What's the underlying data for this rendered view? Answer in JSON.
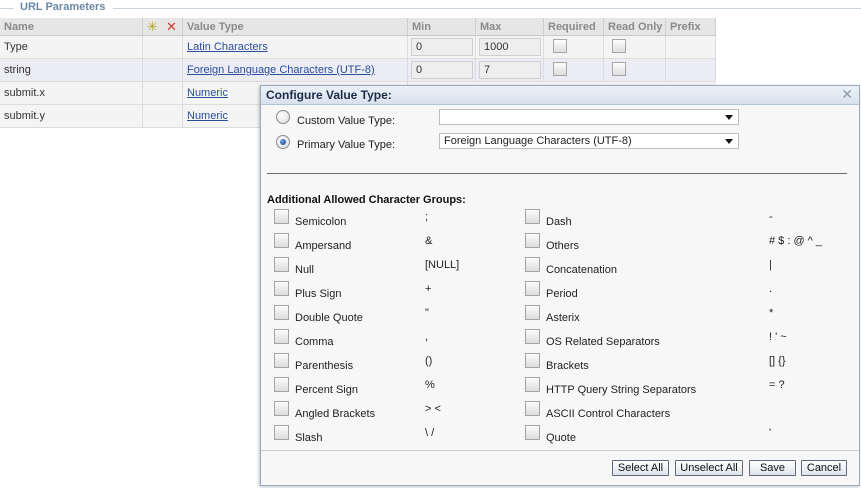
{
  "fieldset": {
    "legend": "URL Parameters"
  },
  "grid": {
    "headers": {
      "name": "Name",
      "value_type": "Value Type",
      "min": "Min",
      "max": "Max",
      "required": "Required",
      "read_only": "Read Only",
      "prefix": "Prefix"
    },
    "rows": [
      {
        "name": "Type",
        "value_type": "Latin Characters",
        "min": "0",
        "max": "1000"
      },
      {
        "name": "string",
        "value_type": "Foreign Language Characters (UTF-8)",
        "min": "0",
        "max": "7"
      },
      {
        "name": "submit.x",
        "value_type": "Numeric"
      },
      {
        "name": "submit.y",
        "value_type": "Numeric"
      }
    ]
  },
  "dialog": {
    "title": "Configure Value Type:",
    "close_icon": "close-icon",
    "custom_label": "Custom Value Type:",
    "custom_value": "",
    "primary_label": "Primary Value Type:",
    "primary_value": "Foreign Language Characters (UTF-8)",
    "section_title": "Additional Allowed Character Groups:",
    "groups_left": [
      {
        "label": "Semicolon",
        "symbol": ";"
      },
      {
        "label": "Ampersand",
        "symbol": "&"
      },
      {
        "label": "Null",
        "symbol": "[NULL]"
      },
      {
        "label": "Plus Sign",
        "symbol": "+"
      },
      {
        "label": "Double Quote",
        "symbol": "\""
      },
      {
        "label": "Comma",
        "symbol": ","
      },
      {
        "label": "Parenthesis",
        "symbol": "()"
      },
      {
        "label": "Percent Sign",
        "symbol": "%"
      },
      {
        "label": "Angled Brackets",
        "symbol": "> <"
      },
      {
        "label": "Slash",
        "symbol": "\\ /"
      }
    ],
    "groups_right": [
      {
        "label": "Dash",
        "symbol": "-"
      },
      {
        "label": "Others",
        "symbol": "# $ : @ ^ _"
      },
      {
        "label": "Concatenation",
        "symbol": "|"
      },
      {
        "label": "Period",
        "symbol": "."
      },
      {
        "label": "Asterix",
        "symbol": "*"
      },
      {
        "label": "OS Related Separators",
        "symbol": "! ' ~"
      },
      {
        "label": "Brackets",
        "symbol": "[] {}"
      },
      {
        "label": "HTTP Query String Separators",
        "symbol": "= ?"
      },
      {
        "label": "ASCII Control Characters",
        "symbol": ""
      },
      {
        "label": "Quote",
        "symbol": "'"
      }
    ],
    "buttons": {
      "select_all": "Select All",
      "unselect_all": "Unselect All",
      "save": "Save",
      "cancel": "Cancel"
    }
  },
  "colors": {
    "legend": "#6a88a6",
    "link": "#2b4f9b",
    "dialog_border": "#9aabc0"
  }
}
